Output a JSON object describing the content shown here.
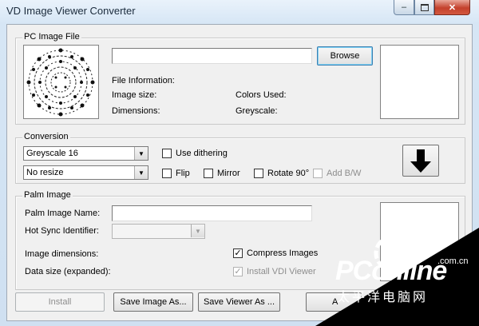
{
  "window": {
    "title": "VD Image Viewer Converter"
  },
  "pc_image": {
    "group_label": "PC Image File",
    "path_value": "",
    "browse_label": "Browse",
    "file_information_label": "File Information:",
    "image_size_label": "Image size:",
    "dimensions_label": "Dimensions:",
    "colors_used_label": "Colors Used:",
    "greyscale_label": "Greyscale:"
  },
  "conversion": {
    "group_label": "Conversion",
    "color_mode_value": "Greyscale 16",
    "resize_value": "No resize",
    "use_dithering_label": "Use dithering",
    "flip_label": "Flip",
    "mirror_label": "Mirror",
    "rotate_label": "Rotate 90°",
    "add_bw_label": "Add B/W"
  },
  "palm_image": {
    "group_label": "Palm Image",
    "name_label": "Palm Image Name:",
    "name_value": "",
    "hotsync_label": "Hot Sync Identifier:",
    "image_dimensions_label": "Image dimensions:",
    "data_size_label": "Data size (expanded):",
    "compress_label": "Compress Images",
    "install_viewer_label": "Install VDI Viewer"
  },
  "buttons": {
    "install": "Install",
    "save_image_as": "Save Image As...",
    "save_viewer_as": "Save Viewer As ...",
    "partial": "A"
  },
  "watermark": {
    "brand": "PConline",
    "domain": ".com.cn",
    "cn": "太平洋电脑网"
  }
}
